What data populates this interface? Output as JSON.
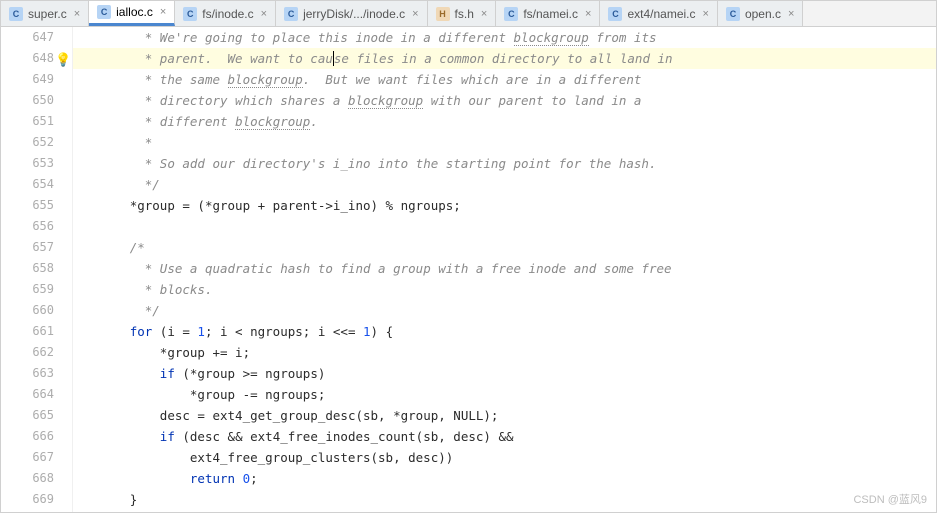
{
  "tabs": [
    {
      "label": "super.c",
      "kind": "c",
      "active": false
    },
    {
      "label": "ialloc.c",
      "kind": "c",
      "active": true
    },
    {
      "label": "fs/inode.c",
      "kind": "c",
      "active": false
    },
    {
      "label": "jerryDisk/.../inode.c",
      "kind": "c",
      "active": false
    },
    {
      "label": "fs.h",
      "kind": "h",
      "active": false
    },
    {
      "label": "fs/namei.c",
      "kind": "c",
      "active": false
    },
    {
      "label": "ext4/namei.c",
      "kind": "c",
      "active": false
    },
    {
      "label": "open.c",
      "kind": "c",
      "active": false
    }
  ],
  "line_start": 647,
  "line_end": 669,
  "highlight_line": 648,
  "bulb_line": 648,
  "caret": {
    "line": 648,
    "after_text": " * parent.  We want to cau"
  },
  "lines": {
    "647": {
      "indent": "        ",
      "tokens": [
        {
          "t": " * We're going to place this inode in a different ",
          "c": "cm"
        },
        {
          "t": "blockgroup",
          "c": "cm u"
        },
        {
          "t": " from its",
          "c": "cm"
        }
      ]
    },
    "648": {
      "indent": "        ",
      "tokens": [
        {
          "t": " * parent.  We want to cau",
          "c": "cm"
        },
        {
          "t": "",
          "caret": true
        },
        {
          "t": "se files in a common directory to all land in",
          "c": "cm"
        }
      ]
    },
    "649": {
      "indent": "        ",
      "tokens": [
        {
          "t": " * the same ",
          "c": "cm"
        },
        {
          "t": "blockgroup",
          "c": "cm u"
        },
        {
          "t": ".  But we want files which are in a different",
          "c": "cm"
        }
      ]
    },
    "650": {
      "indent": "        ",
      "tokens": [
        {
          "t": " * directory which shares a ",
          "c": "cm"
        },
        {
          "t": "blockgroup",
          "c": "cm u"
        },
        {
          "t": " with our parent to land in a",
          "c": "cm"
        }
      ]
    },
    "651": {
      "indent": "        ",
      "tokens": [
        {
          "t": " * different ",
          "c": "cm"
        },
        {
          "t": "blockgroup",
          "c": "cm u"
        },
        {
          "t": ".",
          "c": "cm"
        }
      ]
    },
    "652": {
      "indent": "        ",
      "tokens": [
        {
          "t": " *",
          "c": "cm"
        }
      ]
    },
    "653": {
      "indent": "        ",
      "tokens": [
        {
          "t": " * So add our directory's i_ino into the starting point for the hash.",
          "c": "cm"
        }
      ]
    },
    "654": {
      "indent": "        ",
      "tokens": [
        {
          "t": " */",
          "c": "cm"
        }
      ]
    },
    "655": {
      "indent": "       ",
      "tokens": [
        {
          "t": "*group = (*group + parent->i_ino) % ngroups;",
          "c": ""
        }
      ]
    },
    "656": {
      "indent": "",
      "tokens": []
    },
    "657": {
      "indent": "       ",
      "tokens": [
        {
          "t": "/*",
          "c": "cm"
        }
      ]
    },
    "658": {
      "indent": "        ",
      "tokens": [
        {
          "t": " * Use a quadratic hash to find a group with a free inode and some free",
          "c": "cm"
        }
      ]
    },
    "659": {
      "indent": "        ",
      "tokens": [
        {
          "t": " * blocks.",
          "c": "cm"
        }
      ]
    },
    "660": {
      "indent": "        ",
      "tokens": [
        {
          "t": " */",
          "c": "cm"
        }
      ]
    },
    "661": {
      "indent": "       ",
      "tokens": [
        {
          "t": "for",
          "c": "kw"
        },
        {
          "t": " (i = ",
          "c": ""
        },
        {
          "t": "1",
          "c": "num"
        },
        {
          "t": "; i < ngroups; i <<= ",
          "c": ""
        },
        {
          "t": "1",
          "c": "num"
        },
        {
          "t": ") {",
          "c": ""
        }
      ]
    },
    "662": {
      "indent": "           ",
      "tokens": [
        {
          "t": "*group += i;",
          "c": ""
        }
      ]
    },
    "663": {
      "indent": "           ",
      "tokens": [
        {
          "t": "if",
          "c": "kw"
        },
        {
          "t": " (*group >= ngroups)",
          "c": ""
        }
      ]
    },
    "664": {
      "indent": "               ",
      "tokens": [
        {
          "t": "*group -= ngroups;",
          "c": ""
        }
      ]
    },
    "665": {
      "indent": "           ",
      "tokens": [
        {
          "t": "desc = ext4_get_group_desc(sb, *group, NULL);",
          "c": ""
        }
      ]
    },
    "666": {
      "indent": "           ",
      "tokens": [
        {
          "t": "if",
          "c": "kw"
        },
        {
          "t": " (desc && ext4_free_inodes_count(sb, desc) &&",
          "c": ""
        }
      ]
    },
    "667": {
      "indent": "               ",
      "tokens": [
        {
          "t": "ext4_free_group_clusters(sb, desc))",
          "c": ""
        }
      ]
    },
    "668": {
      "indent": "               ",
      "tokens": [
        {
          "t": "return",
          "c": "kw"
        },
        {
          "t": " ",
          "c": ""
        },
        {
          "t": "0",
          "c": "num"
        },
        {
          "t": ";",
          "c": ""
        }
      ]
    },
    "669": {
      "indent": "       ",
      "tokens": [
        {
          "t": "}",
          "c": ""
        }
      ]
    }
  },
  "watermark": "CSDN @蓝风9"
}
